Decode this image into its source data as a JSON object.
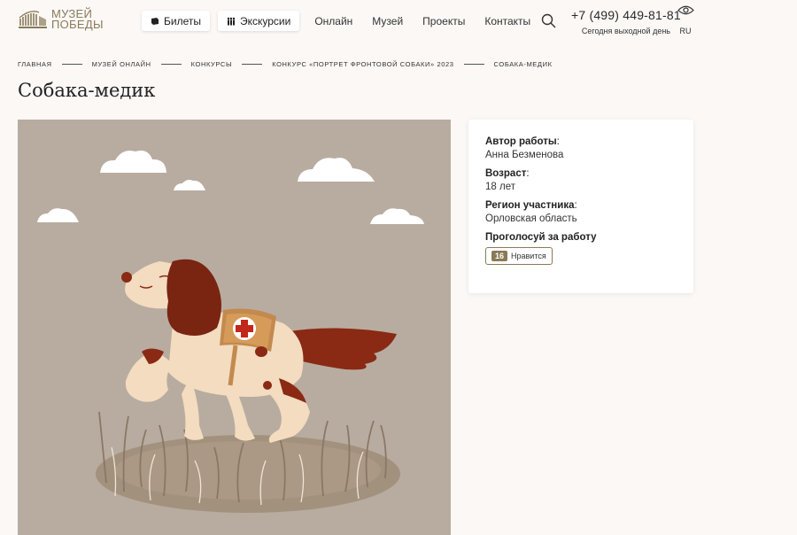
{
  "logo": {
    "line1": "МУЗЕЙ",
    "line2": "ПОБЕДЫ"
  },
  "nav": {
    "tickets": "Билеты",
    "excursions": "Экскурсии",
    "links": [
      "Онлайн",
      "Музей",
      "Проекты",
      "Контакты"
    ]
  },
  "contact": {
    "phone": "+7 (499) 449-81-81",
    "status": "Сегодня выходной день"
  },
  "lang": "RU",
  "breadcrumb": [
    "Главная",
    "Музей онлайн",
    "Конкурсы",
    "Конкурс «Портрет фронтовой собаки» 2023",
    "Собака-медик"
  ],
  "page_title": "Собака-медик",
  "info": {
    "author_label": "Автор работы",
    "author": "Анна Безменова",
    "age_label": "Возраст",
    "age": "18 лет",
    "region_label": "Регион участника",
    "region": "Орловская область",
    "vote_title": "Проголосуй за работу",
    "like_count": "16",
    "like_label": "Нравится"
  },
  "colors": {
    "accent": "#8a7a58",
    "artwork_bg": "#b8aca0",
    "page_bg": "#fbf8f6"
  }
}
